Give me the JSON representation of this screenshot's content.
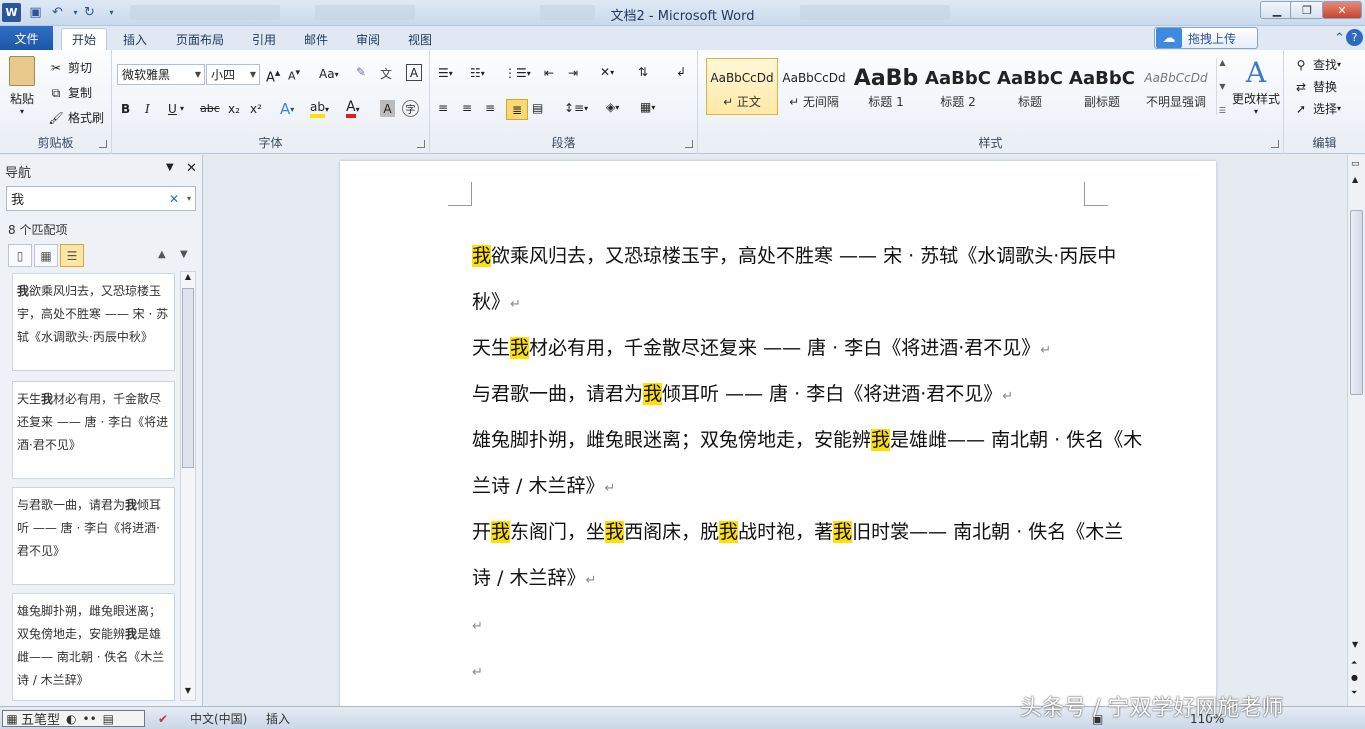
{
  "titlebar": {
    "title": "文档2  -  Microsoft Word",
    "app_icon": "W"
  },
  "tabs": {
    "file": "文件",
    "home": "开始",
    "insert": "插入",
    "layout": "页面布局",
    "references": "引用",
    "mailings": "邮件",
    "review": "审阅",
    "view": "视图"
  },
  "upload": {
    "label": "拖拽上传"
  },
  "clipboard": {
    "paste": "粘贴",
    "cut": "剪切",
    "copy": "复制",
    "format_painter": "格式刷",
    "label": "剪贴板"
  },
  "font": {
    "name": "微软雅黑",
    "size": "小四",
    "label": "字体",
    "bold": "B",
    "italic": "I",
    "underline": "U",
    "strike": "abc",
    "sub": "x₂",
    "sup": "x²",
    "aa_case": "Aa"
  },
  "paragraph": {
    "label": "段落"
  },
  "styles": {
    "label": "样式",
    "items": [
      {
        "preview": "AaBbCcDd",
        "name": "↵ 正文"
      },
      {
        "preview": "AaBbCcDd",
        "name": "↵ 无间隔"
      },
      {
        "preview": "AaBb",
        "name": "标题 1"
      },
      {
        "preview": "AaBbC",
        "name": "标题 2"
      },
      {
        "preview": "AaBbC",
        "name": "标题"
      },
      {
        "preview": "AaBbC",
        "name": "副标题"
      },
      {
        "preview": "AaBbCcDd",
        "name": "不明显强调"
      }
    ],
    "change": "更改样式"
  },
  "editing": {
    "find": "查找",
    "replace": "替换",
    "select": "选择",
    "label": "编辑"
  },
  "nav": {
    "title": "导航",
    "search_value": "我",
    "match_count": "8 个匹配项",
    "results": [
      {
        "pre": "",
        "hit": "我",
        "post": "欲乘风归去，又恐琼楼玉宇，高处不胜寒 —— 宋 · 苏轼《水调歌头·丙辰中秋》"
      },
      {
        "pre": "天生",
        "hit": "我",
        "post": "材必有用，千金散尽还复来 —— 唐 · 李白《将进酒·君不见》"
      },
      {
        "pre": "与君歌一曲，请君为",
        "hit": "我",
        "post": "倾耳听 —— 唐 · 李白《将进酒·君不见》"
      },
      {
        "pre": "雄兔脚扑朔，雌兔眼迷离；双兔傍地走，安能辨",
        "hit": "我",
        "post": "是雄雌—— 南北朝 · 佚名《木兰诗 / 木兰辞》"
      }
    ]
  },
  "document": {
    "lines": [
      {
        "segs": [
          {
            "t": "我",
            "h": true
          },
          {
            "t": "欲乘风归去，又恐琼楼玉宇，高处不胜寒  ——  宋 · 苏轼《水调歌头·丙辰中",
            "h": false
          }
        ]
      },
      {
        "segs": [
          {
            "t": "秋》",
            "h": false
          }
        ],
        "mark": "↵"
      },
      {
        "segs": [
          {
            "t": "天生",
            "h": false
          },
          {
            "t": "我",
            "h": true
          },
          {
            "t": "材必有用，千金散尽还复来 ——  唐 · 李白《将进酒·君不见》",
            "h": false
          }
        ],
        "mark": "↵"
      },
      {
        "segs": [
          {
            "t": "与君歌一曲，请君为",
            "h": false
          },
          {
            "t": "我",
            "h": true
          },
          {
            "t": "倾耳听  ——  唐 · 李白《将进酒·君不见》",
            "h": false
          }
        ],
        "mark": "↵"
      },
      {
        "segs": [
          {
            "t": "雄兔脚扑朔，雌兔眼迷离；双兔傍地走，安能辨",
            "h": false
          },
          {
            "t": "我",
            "h": true
          },
          {
            "t": "是雄雌—— 南北朝 · 佚名《木",
            "h": false
          }
        ]
      },
      {
        "segs": [
          {
            "t": "兰诗 / 木兰辞》",
            "h": false
          }
        ],
        "mark": "↵"
      },
      {
        "segs": [
          {
            "t": "开",
            "h": false
          },
          {
            "t": "我",
            "h": true
          },
          {
            "t": "东阁门，坐",
            "h": false
          },
          {
            "t": "我",
            "h": true
          },
          {
            "t": "西阁床，脱",
            "h": false
          },
          {
            "t": "我",
            "h": true
          },
          {
            "t": "战时袍，著",
            "h": false
          },
          {
            "t": "我",
            "h": true
          },
          {
            "t": "旧时裳—— 南北朝 · 佚名《木兰",
            "h": false
          }
        ]
      },
      {
        "segs": [
          {
            "t": "诗 / 木兰辞》",
            "h": false
          }
        ],
        "mark": "↵"
      },
      {
        "segs": [],
        "mark": "↵"
      },
      {
        "segs": [],
        "mark": "↵"
      }
    ]
  },
  "status": {
    "ime": "五笔型",
    "language": "中文(中国)",
    "insert_mode": "插入",
    "zoom": "110%"
  },
  "watermark": "头条号 / 宁双学好网施老师"
}
